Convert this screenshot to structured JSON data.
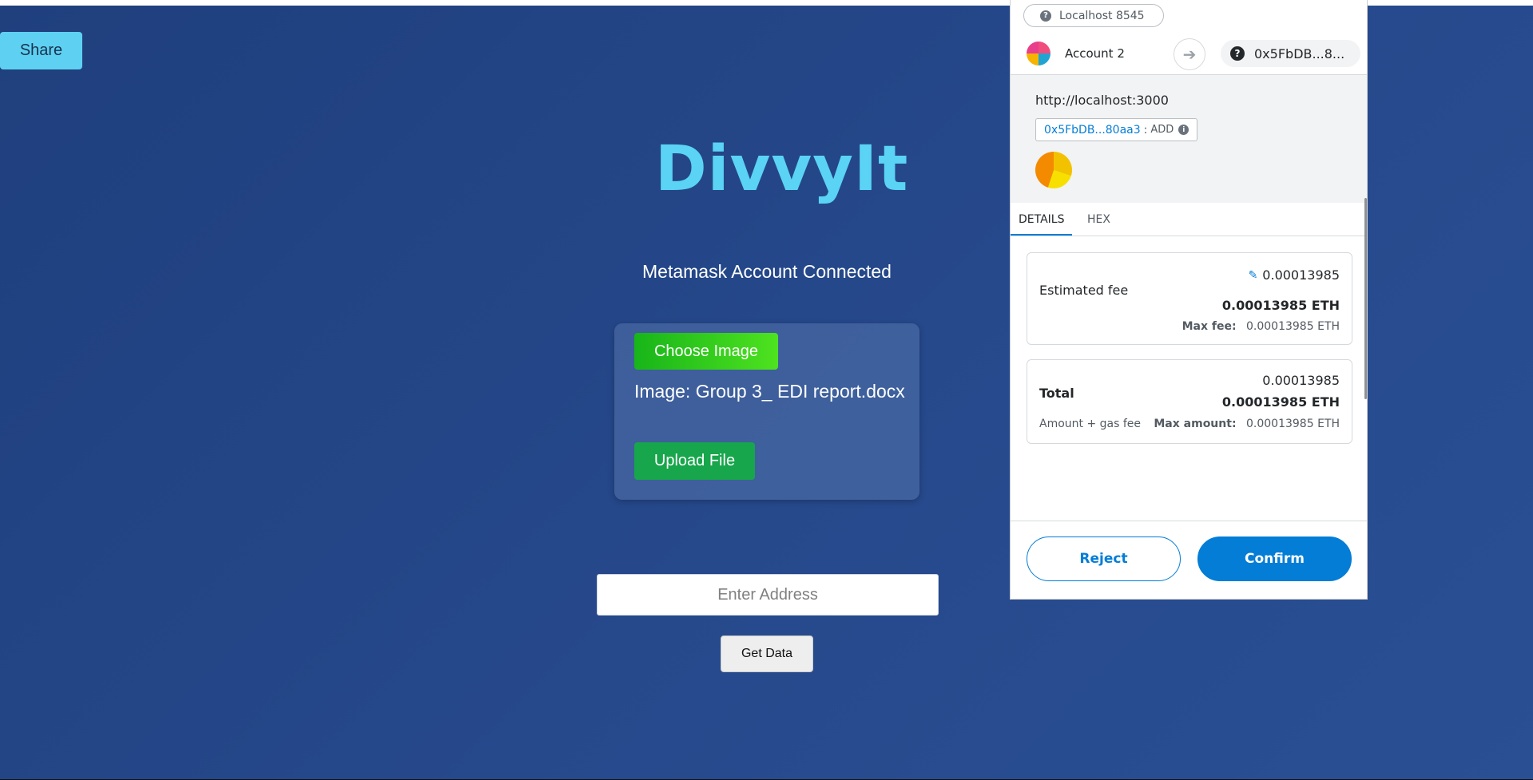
{
  "app": {
    "share_label": "Share",
    "brand": "DivvyIt",
    "status": "Metamask Account Connected",
    "choose_label": "Choose Image",
    "file_label": "Image: Group 3_ EDI report.docx",
    "upload_label": "Upload File",
    "address_placeholder": "Enter Address",
    "get_data_label": "Get Data",
    "colors": {
      "background": "#24468a",
      "brand": "#5ad3f5",
      "share_button": "#5ed1f2",
      "choose_button": "#2fcf1c",
      "upload_button": "#17a64b"
    }
  },
  "metamask": {
    "network": "Localhost 8545",
    "account_name": "Account 2",
    "recipient": "0x5FbDB...8...",
    "origin": "http://localhost:3000",
    "method_address": "0x5FbDB...80aa3",
    "method_sep": ":",
    "method_name": "ADD",
    "tabs": [
      {
        "label": "DETAILS",
        "active": true
      },
      {
        "label": "HEX",
        "active": false
      }
    ],
    "estimated": {
      "label": "Estimated fee",
      "value": "0.00013985",
      "value_eth": "0.00013985 ETH",
      "max_label": "Max fee:",
      "max_value": "0.00013985 ETH"
    },
    "total": {
      "label": "Total",
      "value": "0.00013985",
      "value_eth": "0.00013985 ETH",
      "sub": "Amount + gas fee",
      "max_label": "Max amount:",
      "max_value": "0.00013985 ETH"
    },
    "reject_label": "Reject",
    "confirm_label": "Confirm",
    "icons": [
      "question-icon",
      "arrow-right-icon",
      "info-icon",
      "edit-pencil-icon"
    ],
    "colors": {
      "primary": "#037dd6"
    }
  }
}
